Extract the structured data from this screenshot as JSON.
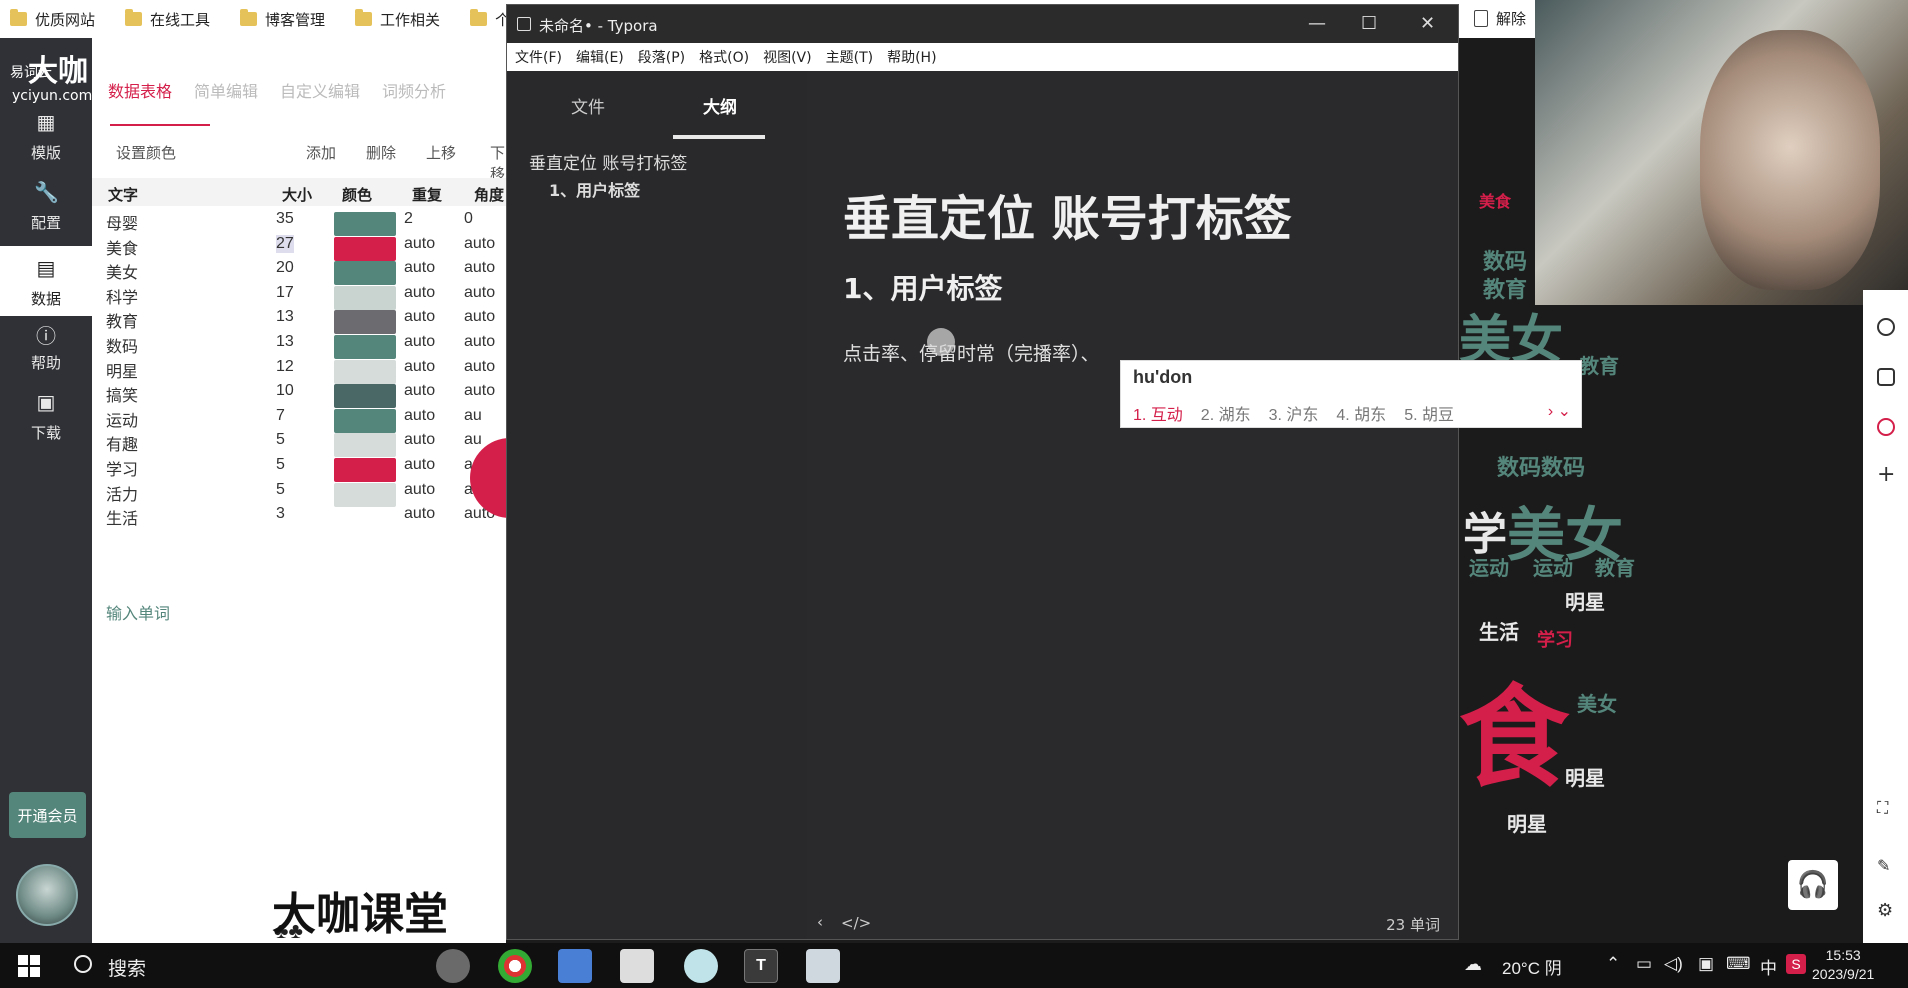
{
  "bookmarks": [
    {
      "label": "优质网站",
      "icon": "folder-icon"
    },
    {
      "label": "在线工具",
      "icon": "folder-icon"
    },
    {
      "label": "博客管理",
      "icon": "folder-icon"
    },
    {
      "label": "工作相关",
      "icon": "folder-icon"
    },
    {
      "label": "个",
      "icon": "folder-icon"
    }
  ],
  "bookmark_right": "解除",
  "app": {
    "logo_big": "大咖",
    "logo_small": "易词云",
    "logo_url": "yciyun.com",
    "sidebar": [
      {
        "label": "模版",
        "icon": "template-icon"
      },
      {
        "label": "配置",
        "icon": "wrench-icon"
      },
      {
        "label": "数据",
        "icon": "inbox-icon",
        "active": true
      },
      {
        "label": "帮助",
        "icon": "help-icon"
      },
      {
        "label": "下载",
        "icon": "save-icon"
      }
    ],
    "vip_label": "开通会员",
    "tabs": [
      "数据表格",
      "简单编辑",
      "自定义编辑",
      "词频分析"
    ],
    "toolbar": {
      "set_color": "设置颜色",
      "add": "添加",
      "delete": "删除",
      "move_up": "上移",
      "move_down": "下移"
    },
    "table": {
      "headers": [
        "文字",
        "大小",
        "颜色",
        "重复",
        "角度"
      ],
      "rows": [
        {
          "word": "母婴",
          "size": "35",
          "color": "#55867b",
          "repeat": "2",
          "angle": "0"
        },
        {
          "word": "美食",
          "size": "27",
          "color": "#d41f4a",
          "repeat": "auto",
          "angle": "auto"
        },
        {
          "word": "美女",
          "size": "20",
          "color": "#55867b",
          "repeat": "auto",
          "angle": "auto"
        },
        {
          "word": "科学",
          "size": "17",
          "color": "#c9d3d0",
          "repeat": "auto",
          "angle": "auto"
        },
        {
          "word": "教育",
          "size": "13",
          "color": "#6b6b70",
          "repeat": "auto",
          "angle": "auto"
        },
        {
          "word": "数码",
          "size": "13",
          "color": "#55867b",
          "repeat": "auto",
          "angle": "auto"
        },
        {
          "word": "明星",
          "size": "12",
          "color": "#d5dcda",
          "repeat": "auto",
          "angle": "auto"
        },
        {
          "word": "搞笑",
          "size": "10",
          "color": "#4a6866",
          "repeat": "auto",
          "angle": "auto"
        },
        {
          "word": "运动",
          "size": "7",
          "color": "#55867b",
          "repeat": "auto",
          "angle": "au"
        },
        {
          "word": "有趣",
          "size": "5",
          "color": "#d5dcda",
          "repeat": "auto",
          "angle": "au"
        },
        {
          "word": "学习",
          "size": "5",
          "color": "#d41f4a",
          "repeat": "auto",
          "angle": "au"
        },
        {
          "word": "活力",
          "size": "5",
          "color": "#d5dcda",
          "repeat": "auto",
          "angle": "auto"
        },
        {
          "word": "生活",
          "size": "3",
          "color": "",
          "repeat": "auto",
          "angle": "auto"
        }
      ]
    },
    "add_word": "输入单词",
    "brand_bottom": "大咖课堂"
  },
  "typora": {
    "title": "未命名• - Typora",
    "menu": [
      "文件(F)",
      "编辑(E)",
      "段落(P)",
      "格式(O)",
      "视图(V)",
      "主题(T)",
      "帮助(H)"
    ],
    "side_tabs": [
      "文件",
      "大纲"
    ],
    "outline": [
      "垂直定位 账号打标签",
      "1、用户标签"
    ],
    "h1": "垂直定位 账号打标签",
    "h2": "1、用户标签",
    "paragraph": "点击率、停留时常（完播率）、",
    "word_count": "23 单词",
    "status_icons": [
      "‹",
      "</>"
    ]
  },
  "ime": {
    "input": "hu'don",
    "candidates": [
      "1. 互动",
      "2. 湖东",
      "3. 沪东",
      "4. 胡东",
      "5. 胡豆"
    ],
    "arrows": "› ⌄"
  },
  "wordcloud_words": [
    {
      "text": "美食",
      "color": "#d41f4a"
    },
    {
      "text": "数码",
      "color": "#55867b"
    },
    {
      "text": "教育",
      "color": "#55867b"
    },
    {
      "text": "美女",
      "color": "#55867b"
    },
    {
      "text": "教育",
      "color": "#55867b"
    },
    {
      "text": "数码数码",
      "color": "#55867b"
    },
    {
      "text": "学",
      "color": "#e8e8e8"
    },
    {
      "text": "美女",
      "color": "#55867b"
    },
    {
      "text": "运动",
      "color": "#55867b"
    },
    {
      "text": "运动",
      "color": "#55867b"
    },
    {
      "text": "教育",
      "color": "#55867b"
    },
    {
      "text": "明星",
      "color": "#e8e8e8"
    },
    {
      "text": "生活",
      "color": "#e8e8e8"
    },
    {
      "text": "学习",
      "color": "#d41f4a"
    },
    {
      "text": "食",
      "color": "#d41f4a"
    },
    {
      "text": "明星",
      "color": "#e8e8e8"
    },
    {
      "text": "美女",
      "color": "#55867b"
    },
    {
      "text": "明星",
      "color": "#e8e8e8"
    }
  ],
  "taskbar": {
    "search": "搜索",
    "weather": "20°C 阴",
    "tray_input": "中",
    "time": "15:53",
    "date": "2023/9/21"
  }
}
